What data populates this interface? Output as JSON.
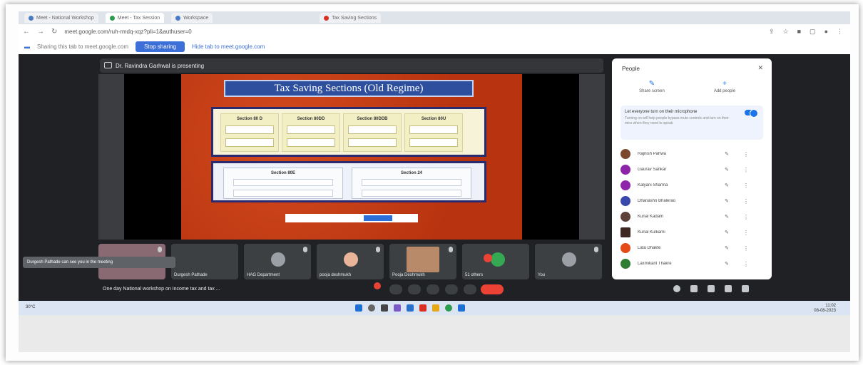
{
  "browser": {
    "tabs": [
      {
        "label": "Meet - National Workshop",
        "color": "#4a79c8"
      },
      {
        "label": "Meet - Tax Session",
        "color": "#2a9d4f"
      },
      {
        "label": "Workspace",
        "color": "#4a79c8"
      },
      {
        "label": "Tax Saving Sections",
        "color": "#d93025"
      }
    ],
    "url": "meet.google.com/ruh-rmdq-xqz?pli=1&authuser=0",
    "sharing_text": "Sharing this tab to meet.google.com",
    "stop_sharing": "Stop sharing",
    "hide_link": "Hide tab to meet.google.com"
  },
  "meet": {
    "presenting_text": "Dr. Ravindra Garhwal is presenting",
    "slide": {
      "title": "Tax Saving Sections (Old Regime)",
      "row1_sections": [
        "Section 80 D",
        "Section 80DD",
        "Section 80DDB",
        "Section 80U"
      ],
      "row2_sections": [
        "Section 80E",
        "Section 24"
      ]
    },
    "tooltip": "Durgesh Pathade can see you in the meeting",
    "tiles": [
      {
        "name": "Durgesh Pathade",
        "avatar": "#c89b86"
      },
      {
        "name": "Durgesh Pathade",
        "avatar": "#5f6368"
      },
      {
        "name": "HAG Department",
        "avatar": "#9aa0a6"
      },
      {
        "name": "pooja deshmukh",
        "avatar": "#e8b49a"
      },
      {
        "name": "Pooja Deshmukh",
        "avatar": "#b88a6a"
      },
      {
        "name": "51 others",
        "avatar": "#34a853"
      },
      {
        "name": "You",
        "avatar": "#9aa0a6"
      }
    ],
    "meeting_title": "One day National workshop on Income tax and tax ..."
  },
  "people": {
    "title": "People",
    "close": "✕",
    "actions": [
      {
        "icon": "✎",
        "label": "Share screen"
      },
      {
        "icon": "+",
        "label": "Add people"
      }
    ],
    "everyone_title": "Let everyone turn on their microphone",
    "everyone_desc": "Turning on will help people bypass mute controls and turn on their mics when they need to speak.",
    "list": [
      {
        "name": "Rajnish Pahwa",
        "color": "#7b4a2e"
      },
      {
        "name": "Gaurav Sankar",
        "color": "#8e24aa"
      },
      {
        "name": "Kalyani Sharma",
        "color": "#8e24aa"
      },
      {
        "name": "Dhanashri Bhalerao",
        "color": "#3949ab"
      },
      {
        "name": "Kunal Kadam",
        "color": "#5d4037"
      },
      {
        "name": "Kunal Kulkarni",
        "color": "#3e2723"
      },
      {
        "name": "Lata Dhakte",
        "color": "#e64a19"
      },
      {
        "name": "Laxmikant Thakre",
        "color": "#2e7d32"
      }
    ]
  },
  "taskbar": {
    "weather": "30°C",
    "time": "11:02",
    "date": "08-08-2023"
  }
}
